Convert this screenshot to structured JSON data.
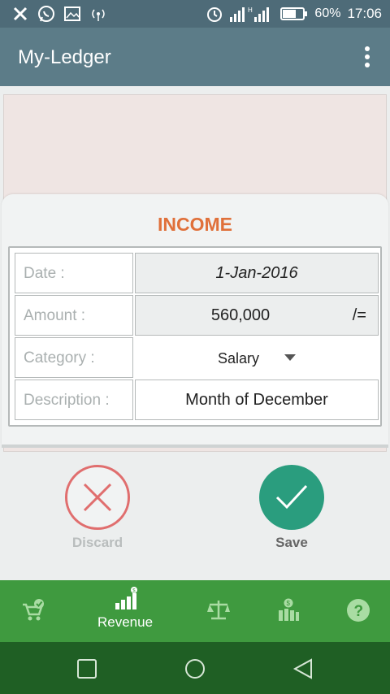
{
  "status_bar": {
    "battery": "60%",
    "time": "17:06",
    "icons": [
      "x-icon",
      "whatsapp-icon",
      "gallery-icon",
      "hotspot-icon",
      "alarm-icon",
      "signal-icon",
      "battery-icon"
    ]
  },
  "app_bar": {
    "title": "My-Ledger"
  },
  "dialog": {
    "title": "INCOME",
    "rows": [
      {
        "label": "Date :",
        "value": "1-Jan-2016"
      },
      {
        "label": "Amount :",
        "value": "560,000",
        "unit": "/="
      },
      {
        "label": "Category :",
        "value": "Salary"
      },
      {
        "label": "Description :",
        "value": "Month of December"
      }
    ]
  },
  "actions": {
    "discard_label": "Discard",
    "save_label": "Save",
    "discard_color": "#e06e6e",
    "save_color": "#2a9d7e"
  },
  "bottom_nav": {
    "items": [
      {
        "icon": "cart-check-icon",
        "label": ""
      },
      {
        "icon": "revenue-chart-icon",
        "label": "Revenue"
      },
      {
        "icon": "balance-scale-icon",
        "label": ""
      },
      {
        "icon": "money-bars-icon",
        "label": ""
      },
      {
        "icon": "help-icon",
        "label": ""
      }
    ],
    "color": "#3f9a3f"
  },
  "system_nav": {
    "icons": [
      "recent-apps-icon",
      "home-icon",
      "back-icon"
    ]
  },
  "colors": {
    "appbar": "#5c7c88",
    "title_accent": "#e0703a"
  }
}
